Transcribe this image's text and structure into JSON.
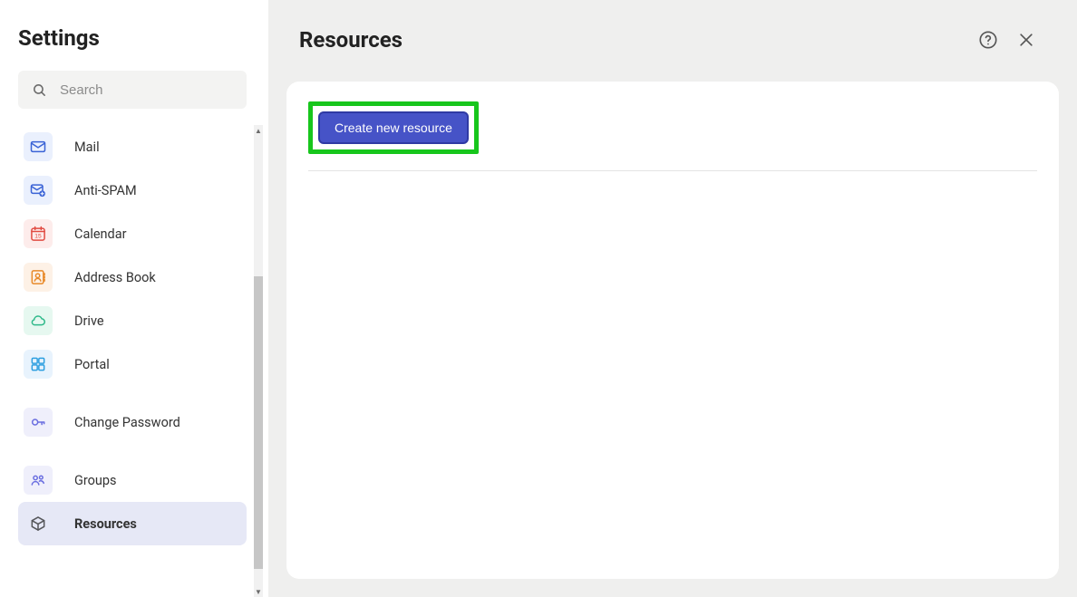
{
  "sidebar": {
    "title": "Settings",
    "search_placeholder": "Search",
    "items": [
      {
        "key": "mail",
        "label": "Mail",
        "icon": "mail-icon",
        "tile_bg": "#eaf0fd",
        "icon_color": "#3a63d6",
        "selected": false
      },
      {
        "key": "anti-spam",
        "label": "Anti-SPAM",
        "icon": "shield-mail-icon",
        "tile_bg": "#eaf0fd",
        "icon_color": "#3a63d6",
        "selected": false
      },
      {
        "key": "calendar",
        "label": "Calendar",
        "icon": "calendar-icon",
        "tile_bg": "#fdeceb",
        "icon_color": "#e14b42",
        "selected": false
      },
      {
        "key": "address-book",
        "label": "Address Book",
        "icon": "address-book-icon",
        "tile_bg": "#fdf1e6",
        "icon_color": "#e88a2a",
        "selected": false
      },
      {
        "key": "drive",
        "label": "Drive",
        "icon": "cloud-icon",
        "tile_bg": "#e6f8f0",
        "icon_color": "#2fb98a",
        "selected": false
      },
      {
        "key": "portal",
        "label": "Portal",
        "icon": "portal-icon",
        "tile_bg": "#e8f3fd",
        "icon_color": "#2d9fe0",
        "selected": false
      },
      {
        "key": "change-password",
        "label": "Change Password",
        "icon": "key-icon",
        "tile_bg": "#efeffb",
        "icon_color": "#6a6ee0",
        "selected": false
      },
      {
        "key": "groups",
        "label": "Groups",
        "icon": "groups-icon",
        "tile_bg": "#efeffb",
        "icon_color": "#6a6ee0",
        "selected": false
      },
      {
        "key": "resources",
        "label": "Resources",
        "icon": "cube-icon",
        "tile_bg": "#e6e8f6",
        "icon_color": "#55565a",
        "selected": true
      }
    ]
  },
  "main": {
    "title": "Resources",
    "create_button_label": "Create new resource"
  },
  "scrollbar": {
    "thumb_top_pct": 32,
    "thumb_height_pct": 62
  }
}
